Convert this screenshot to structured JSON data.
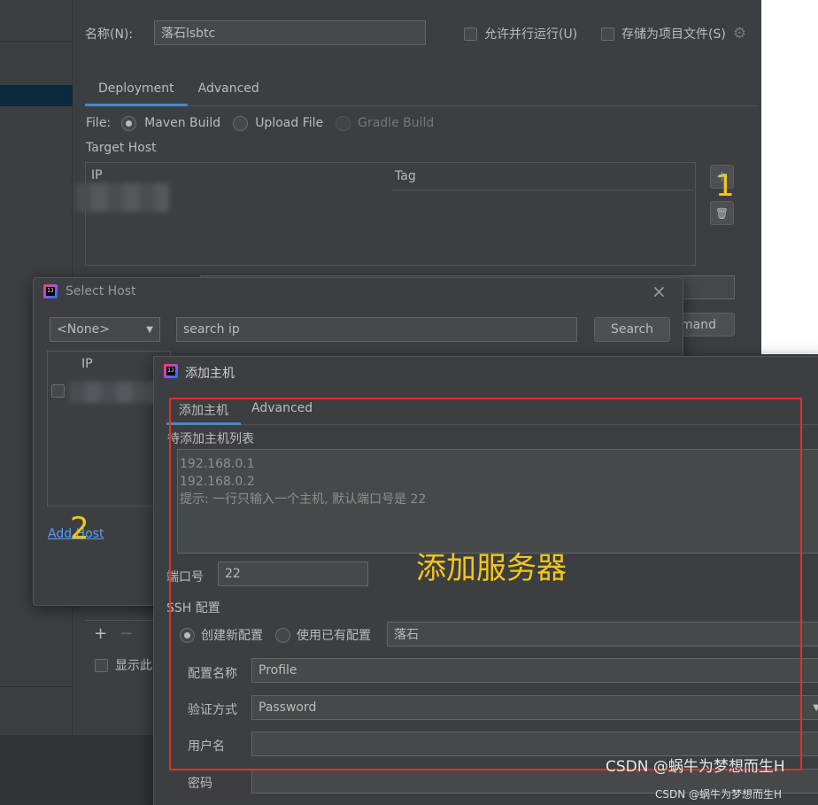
{
  "run_config": {
    "name_label": "名称(N):",
    "name_value": "落石lsbtc",
    "allow_parallel_label": "允许并行运行(U)",
    "store_as_project_label": "存储为项目文件(S)",
    "tabs": [
      "Deployment",
      "Advanced"
    ],
    "file_label": "File:",
    "file_options": [
      "Maven Build",
      "Upload File",
      "Gradle Build"
    ],
    "target_host_label": "Target Host",
    "table_headers": [
      "IP",
      "Tag"
    ],
    "peek_command_btn": "mand",
    "show_page_label": "显示此"
  },
  "select_host": {
    "title": "Select Host",
    "dropdown_value": "<None>",
    "search_value": "search ip",
    "search_button": "Search",
    "table_header_ip": "IP",
    "add_host_link": "Add Host"
  },
  "add_host": {
    "title": "添加主机",
    "tabs": [
      "添加主机",
      "Advanced"
    ],
    "list_label": "待添加主机列表",
    "hosts": [
      "192.168.0.1",
      "192.168.0.2",
      "提示: 一行只输入一个主机, 默认端口号是 22"
    ],
    "port_label": "端口号",
    "port_value": "22",
    "ssh_label": "SSH 配置",
    "new_config_label": "创建新配置",
    "existing_config_label": "使用已有配置",
    "existing_config_value": "落石",
    "profile_name_label": "配置名称",
    "profile_name_value": "Profile",
    "auth_label": "验证方式",
    "auth_value": "Password",
    "username_label": "用户名",
    "password_label": "密码"
  },
  "annotations": {
    "step1": "1",
    "step2": "2",
    "caption": "添加服务器",
    "watermark": "CSDN @蜗牛为梦想而生H",
    "watermark_under": "CSDN @蜗牛为梦想而生H",
    "accent": "#f5c518",
    "box_color": "#e0302a"
  }
}
